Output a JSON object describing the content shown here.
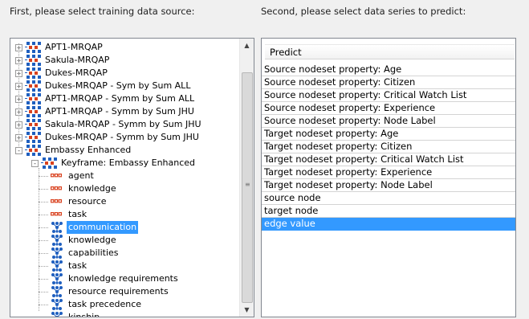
{
  "labels": {
    "left": "First, please select training data source:",
    "right": "Second, please select data series to predict:"
  },
  "tree": [
    {
      "label": "APT1-MRQAP",
      "icon": "network-icon",
      "level": 0,
      "expander": "+"
    },
    {
      "label": "Sakula-MRQAP",
      "icon": "network-icon",
      "level": 0,
      "expander": "+"
    },
    {
      "label": "Dukes-MRQAP",
      "icon": "network-icon",
      "level": 0,
      "expander": "+"
    },
    {
      "label": "Dukes-MRQAP - Sym by Sum ALL",
      "icon": "network-icon",
      "level": 0,
      "expander": "+"
    },
    {
      "label": "APT1-MRQAP - Symm by Sum ALL",
      "icon": "network-icon",
      "level": 0,
      "expander": "+"
    },
    {
      "label": "APT1-MRQAP - Symm by Sum JHU",
      "icon": "network-icon",
      "level": 0,
      "expander": "+"
    },
    {
      "label": "Sakula-MRQAP - Symm by Sum JHU",
      "icon": "network-icon",
      "level": 0,
      "expander": "+"
    },
    {
      "label": "Dukes-MRQAP - Symm by Sum JHU",
      "icon": "network-icon",
      "level": 0,
      "expander": "+"
    },
    {
      "label": "Embassy Enhanced",
      "icon": "network-icon",
      "level": 0,
      "expander": "-"
    },
    {
      "label": "Keyframe: Embassy Enhanced",
      "icon": "network-icon",
      "level": 1,
      "expander": "-"
    },
    {
      "label": "agent",
      "icon": "nodeset-icon",
      "level": 2
    },
    {
      "label": "knowledge",
      "icon": "nodeset-icon",
      "level": 2
    },
    {
      "label": "resource",
      "icon": "nodeset-icon",
      "level": 2
    },
    {
      "label": "task",
      "icon": "nodeset-icon",
      "level": 2
    },
    {
      "label": "communication",
      "icon": "edgeset-icon",
      "level": 2,
      "selected": true
    },
    {
      "label": "knowledge",
      "icon": "edgeset-icon",
      "level": 2
    },
    {
      "label": "capabilities",
      "icon": "edgeset-icon",
      "level": 2
    },
    {
      "label": "task",
      "icon": "edgeset-icon",
      "level": 2
    },
    {
      "label": "knowledge requirements",
      "icon": "edgeset-icon",
      "level": 2
    },
    {
      "label": "resource requirements",
      "icon": "edgeset-icon",
      "level": 2
    },
    {
      "label": "task precedence",
      "icon": "edgeset-icon",
      "level": 2
    },
    {
      "label": "kinship",
      "icon": "edgeset-icon",
      "level": 2
    }
  ],
  "predict": {
    "header": "Predict",
    "rows": [
      "Source nodeset property: Age",
      "Source nodeset property: Citizen",
      "Source nodeset property: Critical Watch List",
      "Source nodeset property: Experience",
      "Source nodeset property: Node Label",
      "Target nodeset property: Age",
      "Target nodeset property: Citizen",
      "Target nodeset property: Critical Watch List",
      "Target nodeset property: Experience",
      "Target nodeset property: Node Label",
      "source node",
      "target node",
      "edge value"
    ],
    "selected_index": 12
  },
  "colors": {
    "selection": "#3399ff",
    "icon_red": "#d9411e",
    "icon_blue": "#1f5fbf"
  },
  "scrollbar": {
    "up": "▲",
    "down": "▼",
    "grip": "≡"
  }
}
